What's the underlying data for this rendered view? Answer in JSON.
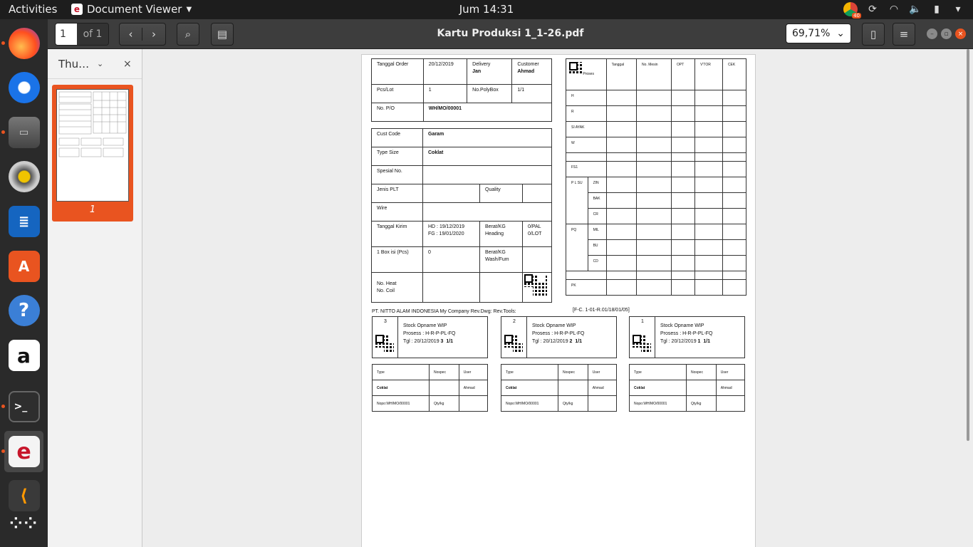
{
  "topbar": {
    "activities": "Activities",
    "app_name": "Document Viewer",
    "clock": "Jum 14:31",
    "chrome_badge": "40"
  },
  "dock": [
    "firefox",
    "thunderbird",
    "files",
    "rhythmbox",
    "writer",
    "software",
    "help",
    "amazon",
    "terminal",
    "document-viewer",
    "sublime",
    "show-apps"
  ],
  "header": {
    "page_current": "1",
    "page_of": "of 1",
    "title": "Kartu Produksi 1_1-26.pdf",
    "zoom": "69,71%"
  },
  "sidebar": {
    "label": "Thu…",
    "thumb_number": "1"
  },
  "form": {
    "main": [
      [
        "Tanggal Order",
        "20/12/2019",
        "Delivery",
        "Jan",
        "Customer",
        "Ahmad"
      ],
      [
        "Pcs/Lot",
        "1",
        "No.PolyBox",
        "1/1"
      ],
      [
        "No. P/O",
        "WH/MO/00001"
      ]
    ],
    "spec": {
      "cust_code": "Cust Code",
      "cust_code_val": "Garam",
      "type_size": "Type Size",
      "type_size_val": "Coklat",
      "spesial": "Spesial No.",
      "jenis": "Jenis PLT",
      "quality": "Quality",
      "wire": "Wire",
      "tgl_kirim": "Tanggal Kirim",
      "hd": "HD : 19/12/2019",
      "fg": "FG : 19/01/2020",
      "berat_heading": "Berat/KG",
      "heading": "Heading",
      "pal": "0/PAL",
      "lot": "0/LOT",
      "boxisi": "1 Box isi (Pcs)",
      "boxisi_val": "0",
      "berat_wash": "Berat/KG",
      "wash": "Wash/Fum",
      "heat": "No. Heat",
      "coil": "No. Coil"
    },
    "process": {
      "headers": [
        "Proses",
        "Tanggal",
        "No. Mesin",
        "OPT",
        "V'TOR",
        "CEK"
      ],
      "rows": [
        "H",
        "R",
        "SI AYAK",
        "W",
        "",
        "FS1"
      ],
      "plsu": "P L SU",
      "plsu_rows": [
        "ZIN",
        "BAK",
        "CR"
      ],
      "pq": "PQ",
      "pq_rows": [
        "MIL",
        "BU",
        "CD"
      ],
      "pk": "PK"
    },
    "footer_left": "PT. NITTO ALAM INDONESIA   My Company   Rev.Dwg:   Rev.Tools:",
    "footer_right": "[F-C. 1-01-R.01/18/01/05]",
    "tags": [
      {
        "n": "3",
        "l1": "Stock Opname WIP",
        "l2": "Prosess : H-R-P-PL-FQ",
        "l3": "Tgl : 20/12/2019",
        "b1": "3",
        "b2": "1/1"
      },
      {
        "n": "2",
        "l1": "Stock Opname WIP",
        "l2": "Prosess : H-R-P-PL-FQ",
        "l3": "Tgl : 20/12/2019",
        "b1": "2",
        "b2": "1/1"
      },
      {
        "n": "1",
        "l1": "Stock Opname WIP",
        "l2": "Prosess : H-R-P-PL-FQ",
        "l3": "Tgl : 20/12/2019",
        "b1": "1",
        "b2": "1/1"
      }
    ],
    "mini": {
      "type": "Type",
      "nospec": "Nospec",
      "user": "User",
      "type_val": "Coklat",
      "user_val": "Ahmad",
      "nopo": "Nopo:WH/MO/00001",
      "qty": "Qty/kg"
    }
  }
}
